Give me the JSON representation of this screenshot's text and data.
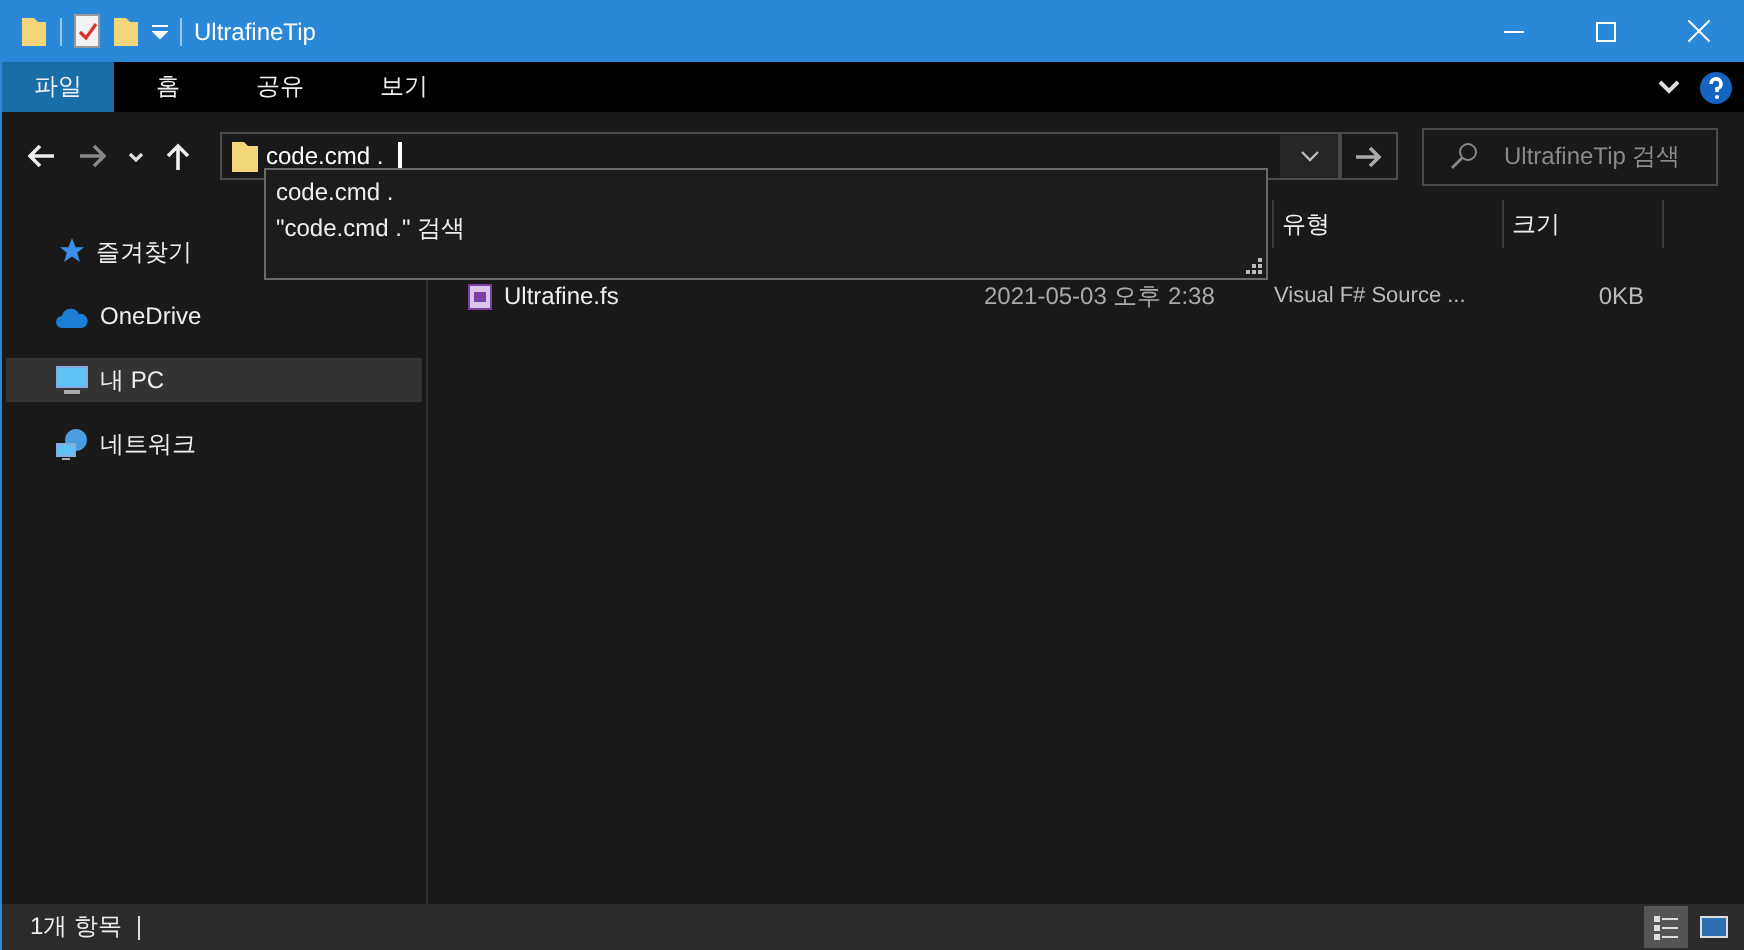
{
  "window": {
    "title": "UltrafineTip"
  },
  "ribbon_tabs": [
    {
      "label": "파일",
      "selected": true
    },
    {
      "label": "홈",
      "selected": false
    },
    {
      "label": "공유",
      "selected": false
    },
    {
      "label": "보기",
      "selected": false
    }
  ],
  "address": {
    "value": "code.cmd ."
  },
  "autocomplete": [
    "code.cmd .",
    "\"code.cmd .\" 검색"
  ],
  "search": {
    "placeholder": "UltrafineTip 검색"
  },
  "sidebar": {
    "items": [
      {
        "label": "즐겨찾기",
        "selected": false
      },
      {
        "label": "OneDrive",
        "selected": false
      },
      {
        "label": "내 PC",
        "selected": true
      },
      {
        "label": "네트워크",
        "selected": false
      }
    ]
  },
  "table": {
    "columns": [
      "유형",
      "크기"
    ],
    "rows": [
      {
        "name": "Ultrafine.fs",
        "date": "2021-05-03 오후 2:38",
        "type": "Visual F# Source ...",
        "size": "0KB"
      }
    ]
  },
  "status_bar": {
    "count": "1개 항목"
  }
}
